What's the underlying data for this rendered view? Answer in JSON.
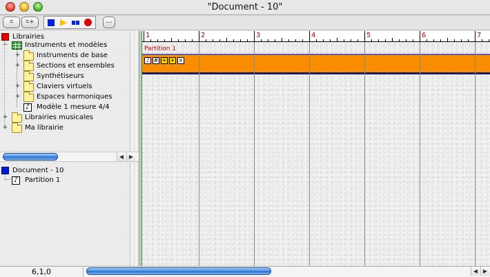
{
  "window": {
    "title": "\"Document - 10\""
  },
  "toolbar": {
    "btn1_label": "⌗",
    "btn2_label": "⌗+",
    "more_label": "..."
  },
  "library_tree": {
    "root": "Librairies",
    "instruments": "Instruments et modèles",
    "items": [
      "Instruments de base",
      "Sections et ensembles",
      "Synthétiseurs",
      "Claviers virtuels",
      "Espaces harmoniques",
      "Modèle 1 mesure 4/4"
    ],
    "libs_musicales": "Librairies musicales",
    "ma_librairie": "Ma librairie"
  },
  "document_tree": {
    "root": "Document - 10",
    "child": "Partition 1"
  },
  "ruler": {
    "measures": [
      "1",
      "2",
      "3",
      "4",
      "5",
      "6",
      "7"
    ]
  },
  "track": {
    "name": "Partition 1",
    "color": "#fa8c00",
    "icons": [
      "note-icon",
      "grid-icon",
      "plus-icon",
      "plus-icon",
      "close-icon"
    ]
  },
  "status": {
    "position": "6,1,0"
  }
}
